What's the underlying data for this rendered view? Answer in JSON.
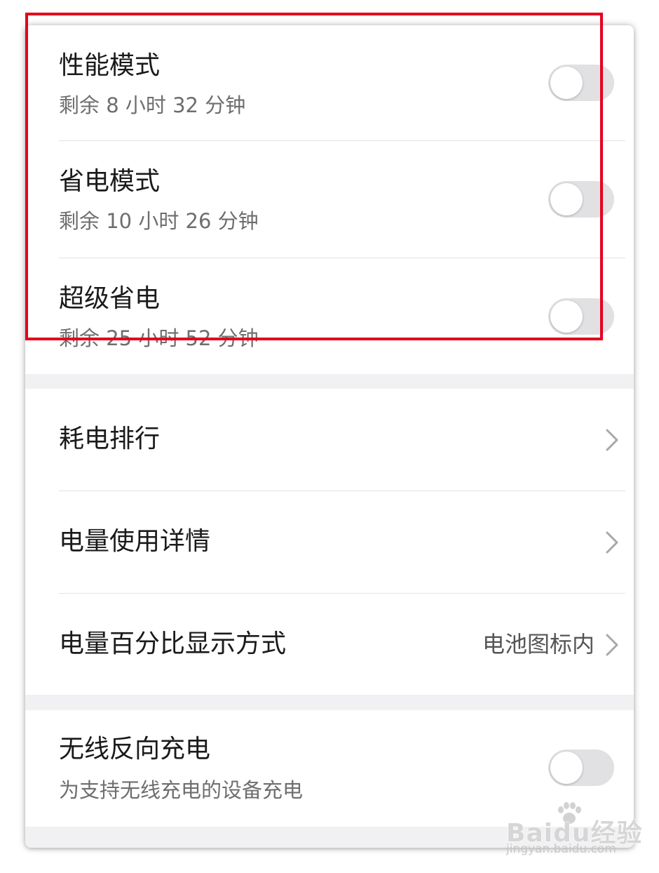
{
  "modes": [
    {
      "title": "性能模式",
      "subtitle": "剩余 8 小时 32 分钟",
      "enabled": false
    },
    {
      "title": "省电模式",
      "subtitle": "剩余 10 小时 26 分钟",
      "enabled": false
    },
    {
      "title": "超级省电",
      "subtitle": "剩余 25 小时 52 分钟",
      "enabled": false
    }
  ],
  "details": {
    "ranking": {
      "label": "耗电排行"
    },
    "usage": {
      "label": "电量使用详情"
    },
    "percent": {
      "label": "电量百分比显示方式",
      "value": "电池图标内"
    }
  },
  "wireless": {
    "title": "无线反向充电",
    "subtitle": "为支持无线充电的设备充电",
    "enabled": false
  },
  "watermark": {
    "brand": "Baidu经验",
    "url": "jingyan.baidu.com"
  },
  "colors": {
    "highlight": "#e5001d",
    "toggle_off": "#e1e1e4",
    "section_gap": "#f1f1f3"
  },
  "icons": {
    "arrow": "chevron-right-icon",
    "switch": "toggle-switch"
  }
}
